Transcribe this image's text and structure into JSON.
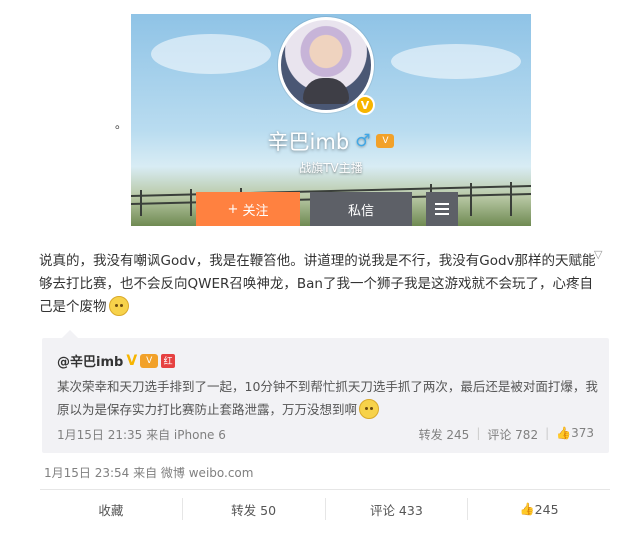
{
  "profile": {
    "name": "辛巴imb",
    "gender_icon": "male-icon",
    "subtitle": "战旗TV主播",
    "follow_label": "关注",
    "follow_prefix": "+",
    "message_label": "私信",
    "verified_mark": "V",
    "badge_text": "V"
  },
  "stray_text": "。",
  "post": {
    "text": "说真的，我没有嘲讽Godv，我是在鞭笞他。讲道理的说我是不行，我没有Godv那样的天赋能够去打比赛，也不会反向QWER召唤神龙，Ban了我一个狮子我是这游戏就不会玩了，心疼自己是个废物",
    "timestamp": "1月15日 23:54 来自 微博 weibo.com",
    "actions": {
      "favorite": "收藏",
      "repost": "转发 50",
      "comment": "评论 433",
      "like": "245"
    }
  },
  "repost": {
    "user": "@辛巴imb",
    "v_mark": "V",
    "hb_mark": "红",
    "text": "某次荣幸和天刀选手排到了一起，10分钟不到帮忙抓天刀选手抓了两次，最后还是被对面打爆，我原以为是保存实力打比赛防止套路泄露，万万没想到啊",
    "timestamp": "1月15日 21:35 来自 iPhone 6",
    "repost_count": "转发 245",
    "comment_count": "评论 782",
    "like_count": "373"
  },
  "colors": {
    "follow": "#ff8140",
    "dark_button": "#5d6067",
    "verified": "#f7b500",
    "repost_bg": "#f2f2f5"
  }
}
